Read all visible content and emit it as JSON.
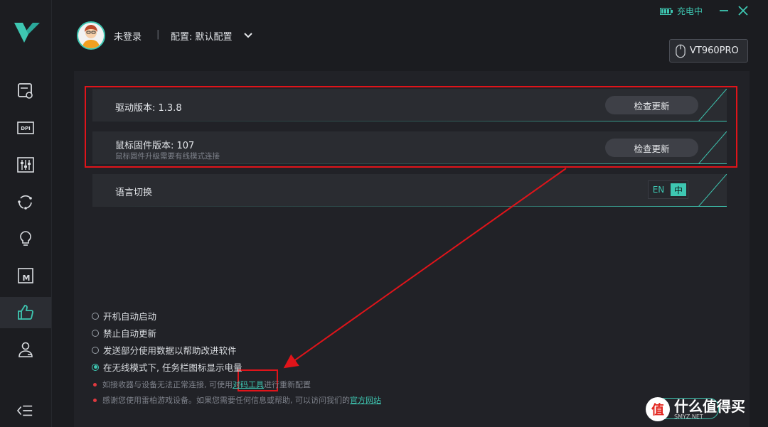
{
  "app": {
    "accent_color": "#3ec7b2",
    "logo_icon": "v-logo-icon"
  },
  "window": {
    "charging_text": "充电中"
  },
  "header": {
    "user_status": "未登录",
    "separator": "|",
    "config_label": "配置: 默认配置"
  },
  "device": {
    "name": "VT960PRO"
  },
  "sidebar": {
    "items": [
      {
        "name": "display-settings-icon",
        "active": false
      },
      {
        "name": "dpi-icon",
        "active": false
      },
      {
        "name": "equalizer-icon",
        "active": false
      },
      {
        "name": "refresh-sync-icon",
        "active": false
      },
      {
        "name": "lightbulb-icon",
        "active": false
      },
      {
        "name": "macro-icon",
        "active": false
      },
      {
        "name": "thumbs-up-icon",
        "active": true
      },
      {
        "name": "user-settings-icon",
        "active": false
      }
    ]
  },
  "settings": {
    "driver": {
      "title": "驱动版本: 1.3.8",
      "button": "检查更新"
    },
    "firmware": {
      "title": "鼠标固件版本:  107",
      "subtitle": "鼠标固件升级需要有线模式连接",
      "button": "检查更新"
    },
    "language": {
      "title": "语言切换",
      "en": "EN",
      "zh": "中",
      "selected": "中"
    }
  },
  "options": [
    {
      "label": "开机自动启动",
      "checked": false
    },
    {
      "label": "禁止自动更新",
      "checked": false
    },
    {
      "label": "发送部分使用数据以帮助改进软件",
      "checked": false
    },
    {
      "label": "在无线模式下, 任务栏图标显示电量",
      "checked": true
    }
  ],
  "notes": {
    "pairing_before": "如接收器与设备无法正常连接, 可使用",
    "pairing_link": "对码工具",
    "pairing_after": "进行重新配置",
    "thanks_before": "感谢您使用雷柏游戏设备。如果您需要任何信息或帮助, 可以访问我们的",
    "thanks_link": "官方网站"
  },
  "watermark": {
    "mark": "值",
    "text": "什么值得买",
    "sub": "SMYZ.NET"
  }
}
